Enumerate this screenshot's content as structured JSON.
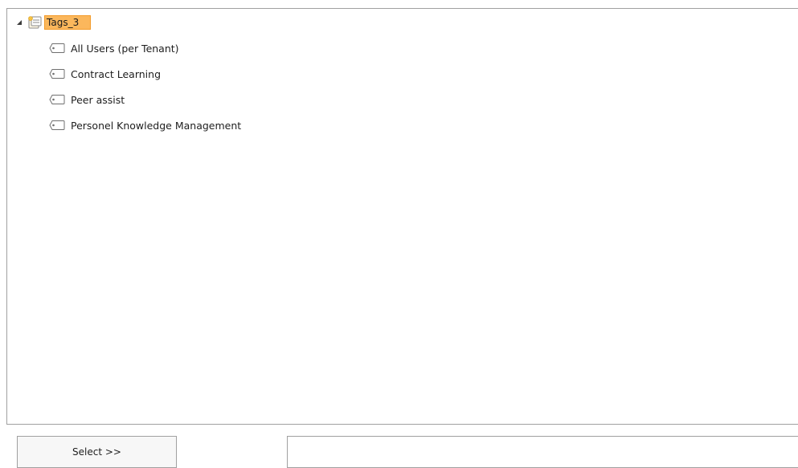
{
  "tree": {
    "root": {
      "label": "Tags_3",
      "expanded": true,
      "icon": "tags-folder-icon"
    },
    "children": [
      {
        "label": "All Users (per Tenant)",
        "icon": "tag-icon"
      },
      {
        "label": "Contract Learning",
        "icon": "tag-icon"
      },
      {
        "label": "Peer assist",
        "icon": "tag-icon"
      },
      {
        "label": "Personel Knowledge Management",
        "icon": "tag-icon"
      }
    ]
  },
  "actions": {
    "select_label": "Select >>"
  },
  "output": {
    "value": ""
  },
  "colors": {
    "selection_fill": "#fbb75c",
    "selection_border": "#f39b2a",
    "panel_border": "#a0a0a0"
  }
}
